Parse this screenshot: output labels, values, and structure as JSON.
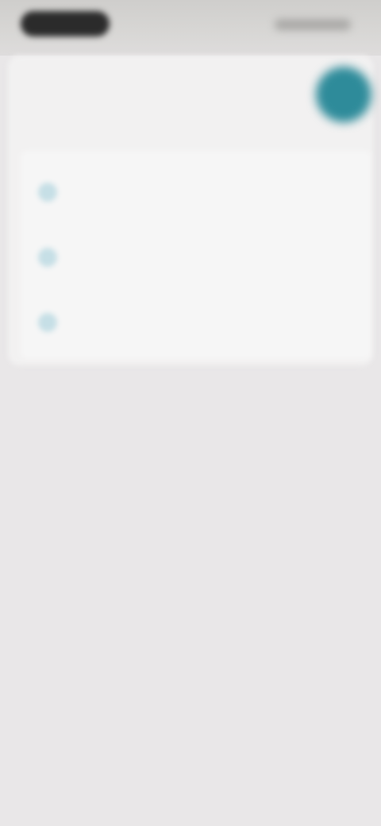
{
  "dialog": {
    "title": "",
    "items": [
      {
        "title": "",
        "subtitle": "",
        "icon": "item-icon"
      },
      {
        "title": "",
        "subtitle": "",
        "icon": "item-icon"
      },
      {
        "title": "",
        "subtitle": "",
        "icon": "item-icon"
      }
    ]
  },
  "colors": {
    "background": "#e9e7e8",
    "fab": "#2e8b9a",
    "icon_tint": "#c6dfe6"
  }
}
